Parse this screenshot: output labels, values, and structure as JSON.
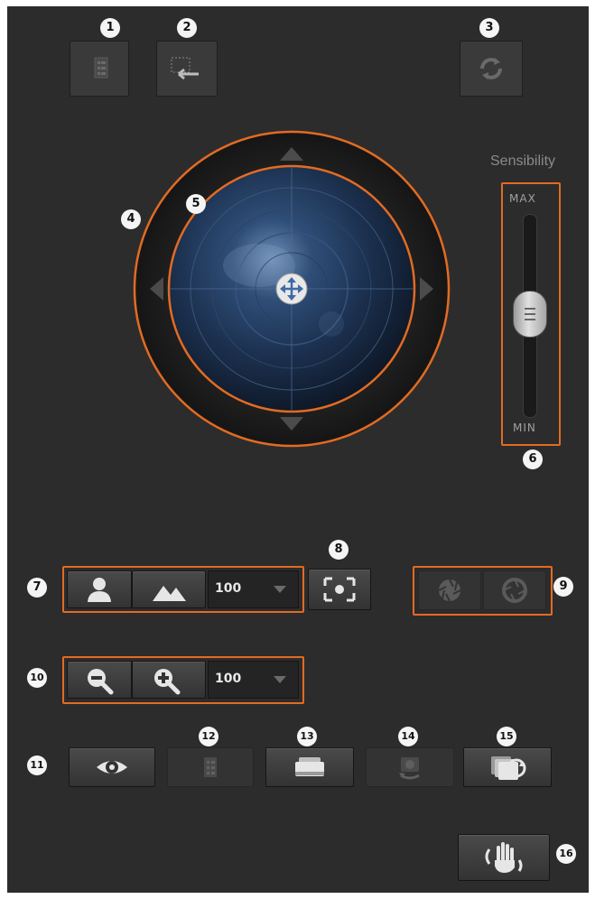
{
  "badges": [
    "1",
    "2",
    "3",
    "4",
    "5",
    "6",
    "7",
    "8",
    "9",
    "10",
    "11",
    "12",
    "13",
    "14",
    "15",
    "16"
  ],
  "toolbar": {
    "list_icon": "list-icon",
    "back_icon": "return-icon",
    "refresh_icon": "refresh-icon"
  },
  "joystick": {
    "center_icon": "move-icon"
  },
  "sensibility": {
    "title": "Sensibility",
    "max_label": "MAX",
    "min_label": "MIN"
  },
  "focus_row": {
    "value": "100"
  },
  "zoom_row": {
    "value": "100"
  },
  "colors": {
    "panel_bg": "#2c2c2c",
    "highlight": "#e36b22",
    "badge_bg": "#f5f5f5"
  }
}
